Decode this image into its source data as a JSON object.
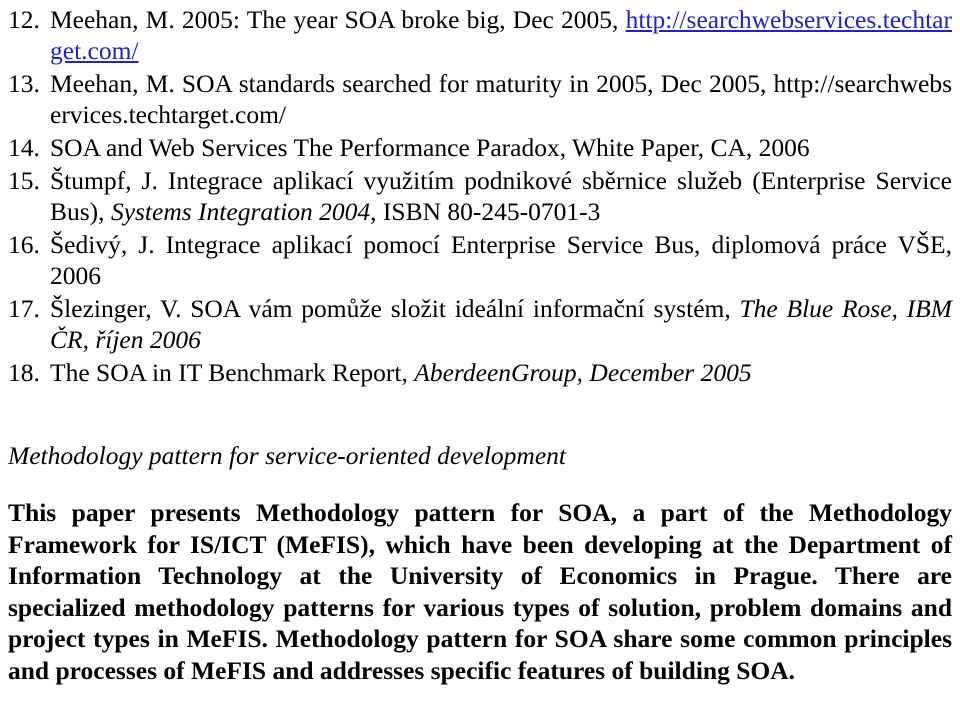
{
  "document": {
    "references": [
      {
        "number": "12.",
        "segments": [
          {
            "type": "text",
            "text": "Meehan, M. 2005: The year SOA broke big, Dec 2005, "
          },
          {
            "type": "link",
            "text": "http://searchwebservices.techtarget.com/"
          }
        ],
        "plain": "Meehan, M. 2005: The year SOA broke big, Dec 2005, http://searchwebservices.techtarget.com/"
      },
      {
        "number": "13.",
        "segments": [
          {
            "type": "text",
            "text": "Meehan, M. SOA standards searched for maturity in 2005, Dec 2005, "
          },
          {
            "type": "url",
            "text": "http://searchwebservices.techtarget.com/"
          }
        ],
        "plain": "Meehan, M. SOA standards searched for maturity in 2005, Dec 2005, http://searchwebservices.techtarget.com/"
      },
      {
        "number": "14.",
        "segments": [
          {
            "type": "text",
            "text": "SOA and Web Services The Performance Paradox, White Paper, CA, 2006"
          }
        ],
        "plain": "SOA and Web Services The Performance Paradox, White Paper, CA, 2006"
      },
      {
        "number": "15.",
        "segments": [
          {
            "type": "text",
            "text": "Štumpf, J. Integrace aplikací využitím podnikové sběrnice služeb (Enterprise Service Bus), "
          },
          {
            "type": "italic",
            "text": "Systems Integration 2004"
          },
          {
            "type": "text",
            "text": ", ISBN 80-245-0701-3"
          }
        ],
        "plain": "Štumpf, J. Integrace aplikací využitím podnikové sběrnice služeb (Enterprise Service Bus), Systems Integration 2004, ISBN 80-245-0701-3"
      },
      {
        "number": "16.",
        "segments": [
          {
            "type": "text",
            "text": "Šedivý, J. Integrace aplikací pomocí Enterprise Service Bus, diplomová práce VŠE, 2006"
          }
        ],
        "plain": "Šedivý, J. Integrace aplikací pomocí Enterprise Service Bus, diplomová práce VŠE, 2006"
      },
      {
        "number": "17.",
        "segments": [
          {
            "type": "text",
            "text": "Šlezinger, V. SOA vám pomůže složit ideální informační systém, "
          },
          {
            "type": "italic",
            "text": "The Blue Rose, IBM ČR, říjen 2006"
          }
        ],
        "plain": "Šlezinger, V. SOA vám pomůže složit ideální informační systém, The Blue Rose, IBM ČR, říjen 2006"
      },
      {
        "number": "18.",
        "segments": [
          {
            "type": "text",
            "text": "The SOA in IT Benchmark Report, "
          },
          {
            "type": "italic",
            "text": "AberdeenGroup, December 2005"
          }
        ],
        "plain": "The SOA in IT Benchmark Report, AberdeenGroup, December 2005"
      }
    ],
    "abstract": {
      "title": "Methodology pattern for service-oriented development",
      "body": "This paper presents Methodology pattern for SOA, a part of the Methodology Framework for IS/ICT (MeFIS), which have been developing at the Department of Information Technology at the University of Economics in Prague.  There are specialized methodology patterns for various types of solution, problem domains and project types in MeFIS.  Methodology pattern for SOA share some common principles and processes of MeFIS and addresses specific features of building SOA."
    },
    "colors": {
      "hyperlink": "#2222cc",
      "text": "#000000",
      "background": "#ffffff"
    }
  }
}
